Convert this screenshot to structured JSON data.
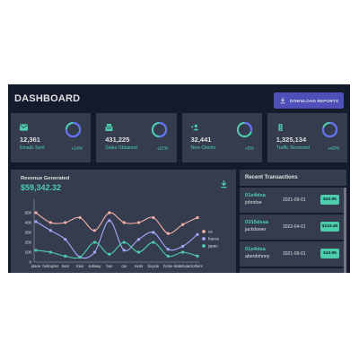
{
  "header": {
    "title": "DASHBOARD",
    "download_label": "DOWNLOAD REPORTS"
  },
  "stats": [
    {
      "value": "12,361",
      "label": "Emails Sent",
      "increase": "+14%",
      "progress": 0.75,
      "icon": "email-icon"
    },
    {
      "value": "431,225",
      "label": "Sales Obtained",
      "increase": "+21%",
      "progress": 0.5,
      "icon": "point-of-sale-icon"
    },
    {
      "value": "32,441",
      "label": "New Clients",
      "increase": "+5%",
      "progress": 0.3,
      "icon": "person-add-icon"
    },
    {
      "value": "1,325,134",
      "label": "Traffic Received",
      "increase": "+43%",
      "progress": 0.8,
      "icon": "traffic-icon"
    }
  ],
  "revenue": {
    "title": "Revenue Generated",
    "amount": "$59,342.32"
  },
  "chart_data": {
    "type": "line",
    "categories": [
      "plane",
      "helicopter",
      "boat",
      "train",
      "subway",
      "bus",
      "car",
      "moto",
      "bicycle",
      "horse",
      "skateboard",
      "others"
    ],
    "ylim": [
      0,
      600
    ],
    "yticks": [
      0,
      100,
      200,
      300,
      400,
      500
    ],
    "series": [
      {
        "name": "us",
        "color": "#f2b0a8",
        "values": [
          500,
          400,
          400,
          450,
          320,
          500,
          400,
          400,
          450,
          290,
          380,
          450
        ]
      },
      {
        "name": "france",
        "color": "#a4a9fc",
        "values": [
          410,
          320,
          230,
          50,
          100,
          420,
          120,
          230,
          300,
          130,
          160,
          280
        ]
      },
      {
        "name": "japan",
        "color": "#4cceac",
        "values": [
          120,
          100,
          60,
          50,
          200,
          80,
          200,
          100,
          200,
          60,
          100,
          60
        ]
      }
    ],
    "legend_position": "right"
  },
  "transactions": {
    "title": "Recent Transactions",
    "rows": [
      {
        "id": "01e4dsa",
        "user": "johndoe",
        "date": "2021-09-01",
        "cost": "$43.95"
      },
      {
        "id": "0315dsaa",
        "user": "jackdower",
        "date": "2022-04-01",
        "cost": "$133.45"
      },
      {
        "id": "01e4dsa",
        "user": "aberdohnny",
        "date": "2021-09-01",
        "cost": "$43.95"
      }
    ]
  },
  "colors": {
    "background": "#141b2d",
    "panel": "#353c4e",
    "accent": "#4cceac",
    "button": "#4e4fb8",
    "ring": "#6870fa"
  }
}
